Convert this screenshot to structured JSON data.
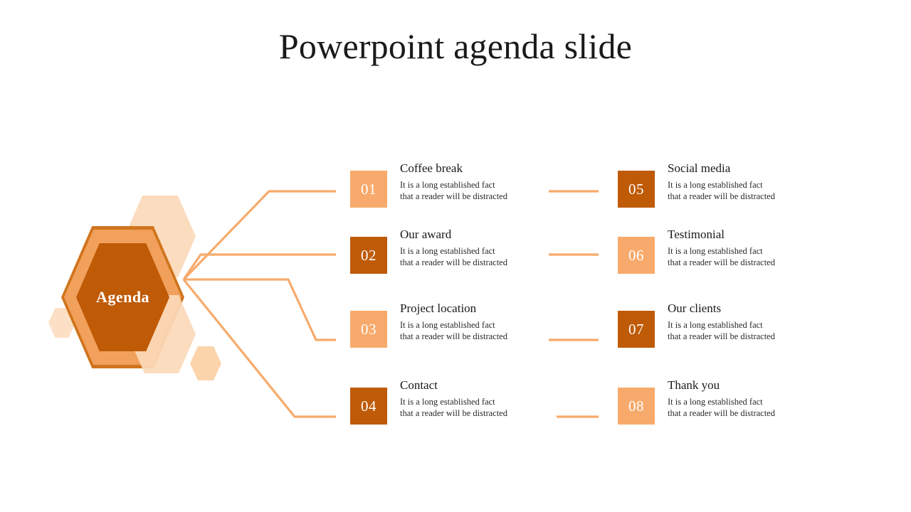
{
  "slide": {
    "title": "Powerpoint agenda slide",
    "hub_label": "Agenda",
    "accent_light": "#f7aa6b",
    "accent_dark": "#bf5a06",
    "accent_pale": "#fcd9b8",
    "connector_color": "#f7aa6b",
    "background": "#ffffff"
  },
  "items": [
    {
      "number": "01",
      "title": "Coffee break",
      "body_line1": "It is a long established fact",
      "body_line2": "that a reader will be distracted",
      "tone": "light"
    },
    {
      "number": "02",
      "title": "Our award",
      "body_line1": "It is a long established fact",
      "body_line2": "that a reader will be distracted",
      "tone": "dark"
    },
    {
      "number": "03",
      "title": "Project location",
      "body_line1": "It is a long established fact",
      "body_line2": "that a reader will be distracted",
      "tone": "light"
    },
    {
      "number": "04",
      "title": "Contact",
      "body_line1": "It is a long established fact",
      "body_line2": "that a reader will be distracted",
      "tone": "dark"
    },
    {
      "number": "05",
      "title": "Social media",
      "body_line1": "It is a long established fact",
      "body_line2": "that a reader will be distracted",
      "tone": "dark"
    },
    {
      "number": "06",
      "title": "Testimonial",
      "body_line1": "It is a long established fact",
      "body_line2": "that a reader will be distracted",
      "tone": "light"
    },
    {
      "number": "07",
      "title": "Our clients",
      "body_line1": "It is a long established fact",
      "body_line2": "that a reader will be distracted",
      "tone": "dark"
    },
    {
      "number": "08",
      "title": "Thank you",
      "body_line1": "It is a long established fact",
      "body_line2": "that a reader will be distracted",
      "tone": "light"
    }
  ]
}
